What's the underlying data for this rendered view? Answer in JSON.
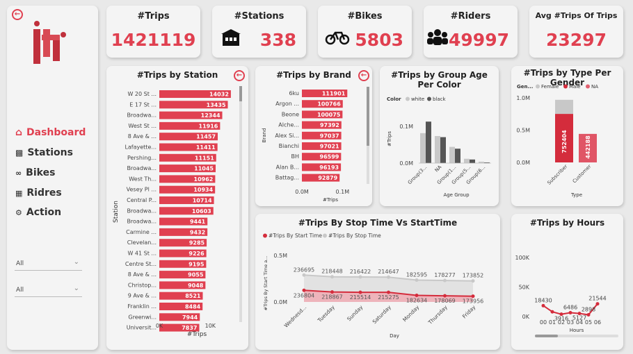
{
  "sidebar": {
    "nav": [
      {
        "label": "Dashboard",
        "icon": "home-icon"
      },
      {
        "label": "Stations",
        "icon": "station-icon"
      },
      {
        "label": "Bikes",
        "icon": "bike-icon"
      },
      {
        "label": "Ridres",
        "icon": "bar-chart-icon"
      },
      {
        "label": "Action",
        "icon": "gears-icon"
      }
    ],
    "filter1": "All",
    "filter2": "All"
  },
  "kpis": {
    "trips": {
      "title": "#Trips",
      "value": "1421119"
    },
    "stations": {
      "title": "#Stations",
      "value": "338"
    },
    "bikes": {
      "title": "#Bikes",
      "value": "5803"
    },
    "riders": {
      "title": "#Riders",
      "value": "49997"
    },
    "avg": {
      "title": "Avg #Trips Of Trips",
      "value": "23297"
    }
  },
  "colors": {
    "accent": "#e04050",
    "grey": "#c8c8c8",
    "dark": "#555555"
  },
  "station_chart": {
    "title": "#Trips by Station",
    "xlabel": "#Trips",
    "ylabel": "Station",
    "ticks": [
      "0K",
      "10K"
    ],
    "stations": [
      "W 20 St ...",
      "E 17 St ...",
      "Broadwa...",
      "West St ...",
      "8 Ave & ...",
      "Lafayette...",
      "Pershing...",
      "Broadwa...",
      "West Th...",
      "Vesey Pl ...",
      "Central P...",
      "Broadwa...",
      "Broadwa...",
      "Carmine ...",
      "Clevelan...",
      "W 41 St ...",
      "Centre St...",
      "8 Ave & ...",
      "Christop...",
      "9 Ave & ...",
      "Franklin ...",
      "Greenwi...",
      "Universit..."
    ],
    "values": [
      14032,
      13435,
      12344,
      11916,
      11457,
      11411,
      11151,
      11045,
      10962,
      10934,
      10714,
      10603,
      9441,
      9432,
      9285,
      9226,
      9195,
      9055,
      9048,
      8521,
      8484,
      7944,
      7837
    ]
  },
  "brand_chart": {
    "title": "#Trips by Brand",
    "xlabel": "#Trips",
    "ylabel": "Brand",
    "ticks": [
      "0.0M",
      "0.1M"
    ],
    "brands": [
      "6ku",
      "Argon ...",
      "Beone",
      "Alche...",
      "Alex Si...",
      "Bianchi",
      "BH",
      "Alan B...",
      "Battag..."
    ],
    "values": [
      111901,
      100766,
      100075,
      97392,
      97037,
      97021,
      96599,
      96193,
      92879
    ]
  },
  "age_chart": {
    "title": "#Trips by Group Age Per Color",
    "legend_title": "Color",
    "legend": [
      "white",
      "black"
    ],
    "ylabel": "#Trips",
    "xlabel": "Age Group",
    "ticks": [
      "0.0M",
      "0.1M"
    ],
    "categories": [
      "Group(3...",
      "NA",
      "Group(1...",
      "Group(5...",
      "Group(6..."
    ],
    "white": [
      0.083,
      0.075,
      0.045,
      0.012,
      0.004
    ],
    "black": [
      0.115,
      0.072,
      0.04,
      0.01,
      0.002
    ]
  },
  "gender_chart": {
    "title": "#Trips by Type Per Gender",
    "legend_title": "Gen...",
    "legend": [
      "Female",
      "Male",
      "NA"
    ],
    "xlabel": "Type",
    "ticks": [
      "1.0M",
      "0.5M",
      "0.0M"
    ],
    "categories": [
      "Subscriber",
      "Customer"
    ],
    "male_labels": [
      "752404",
      "442188"
    ]
  },
  "line_chart": {
    "title": "#Trips By Stop Time Vs StartTime",
    "legend": [
      "#Trips By Start Time",
      "#Trips By Stop Time"
    ],
    "ylabel": "#Trips By Start Time a...",
    "xlabel": "Day",
    "ticks": [
      "0.5M",
      "0.0M"
    ],
    "days": [
      "Wednesd...",
      "Tuesday",
      "Sunday",
      "Saturday",
      "Monday",
      "Thursday",
      "Friday"
    ],
    "stop": [
      236695,
      218448,
      216422,
      214647,
      182595,
      178277,
      173852
    ],
    "start": [
      236804,
      218867,
      215514,
      215275,
      182634,
      178069,
      173956
    ],
    "stop_labels": [
      "236695",
      "218448",
      "216422",
      "214647",
      "182595",
      "178277",
      "173852"
    ],
    "start_labels": [
      "236804",
      "218867",
      "215514",
      "215275",
      "182634",
      "178069",
      "173956"
    ]
  },
  "hours_chart": {
    "title": "#Trips by Hours",
    "xlabel": "Hours",
    "ticks": [
      "100K",
      "50K",
      "0K"
    ],
    "hours": [
      "00",
      "01",
      "02",
      "03",
      "04",
      "05",
      "06"
    ],
    "values": [
      18430,
      8000,
      3916,
      6486,
      5127,
      2898,
      21544
    ],
    "labels": [
      "18430",
      "",
      "3916",
      "6486",
      "5127",
      "2898",
      "21544"
    ]
  }
}
